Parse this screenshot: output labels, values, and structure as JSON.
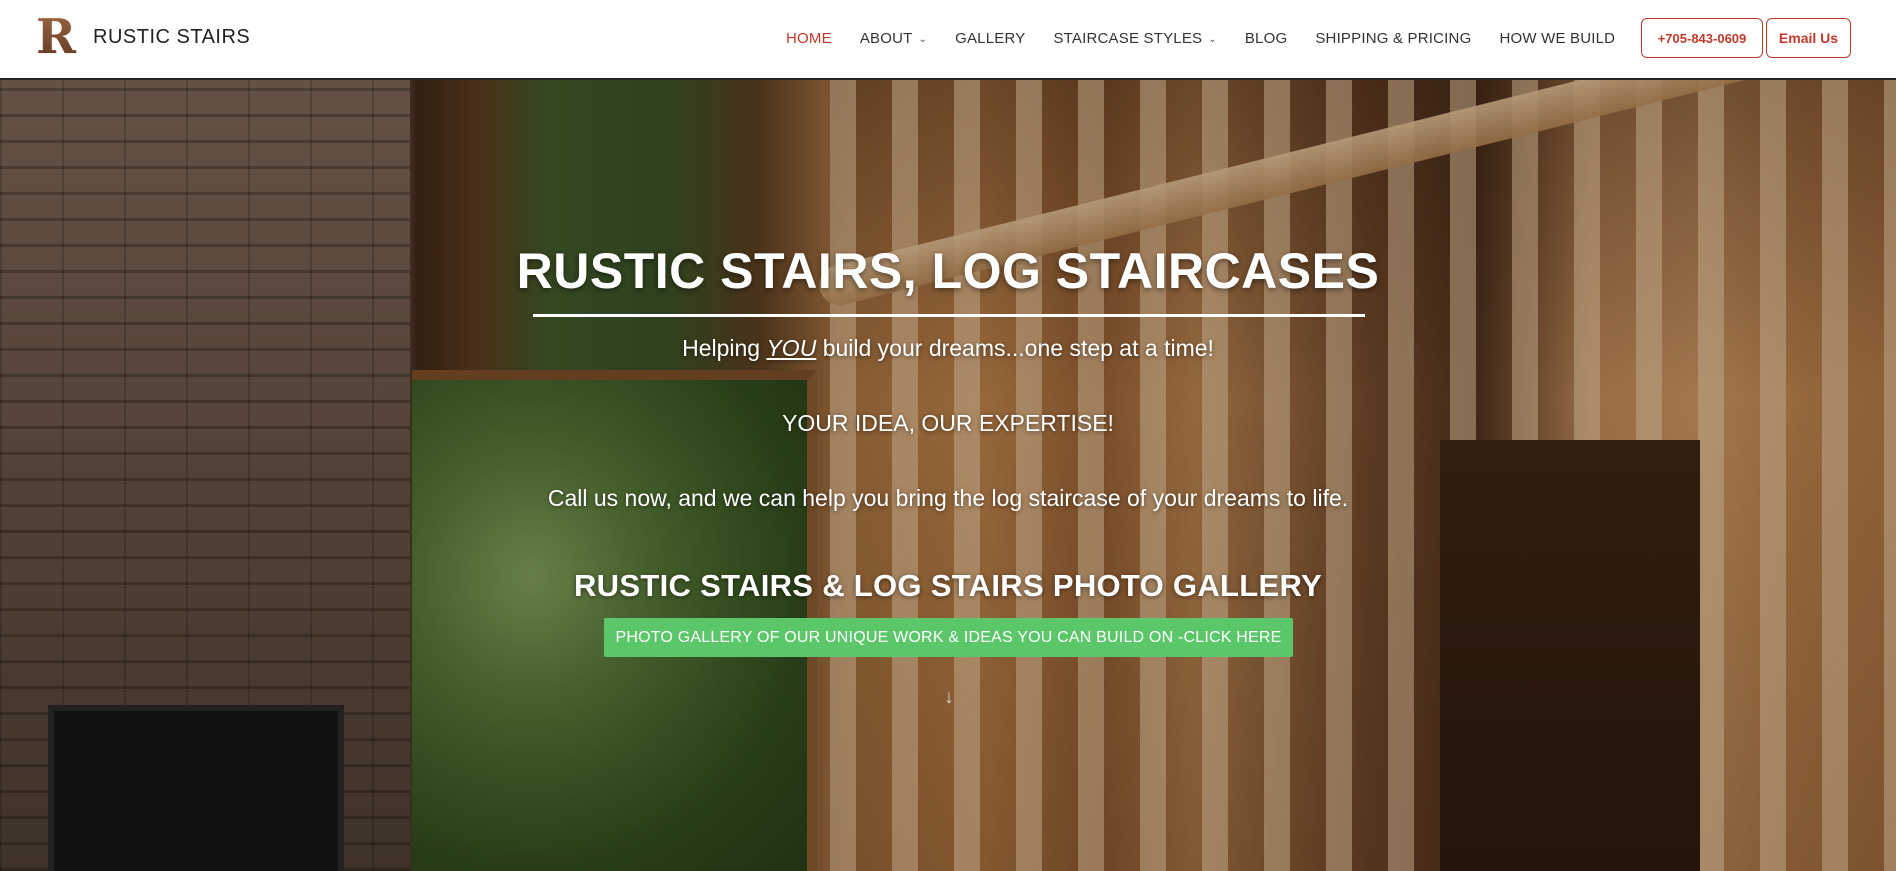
{
  "brand": {
    "logo_letter": "R",
    "name": "RUSTIC STAIRS"
  },
  "nav": {
    "items": [
      {
        "label": "HOME",
        "active": true,
        "dropdown": false
      },
      {
        "label": "ABOUT",
        "active": false,
        "dropdown": true
      },
      {
        "label": "GALLERY",
        "active": false,
        "dropdown": false
      },
      {
        "label": "STAIRCASE STYLES",
        "active": false,
        "dropdown": true
      },
      {
        "label": "BLOG",
        "active": false,
        "dropdown": false
      },
      {
        "label": "SHIPPING & PRICING",
        "active": false,
        "dropdown": false
      },
      {
        "label": "HOW WE BUILD",
        "active": false,
        "dropdown": false
      }
    ],
    "caret_icon": "chevron-down-icon",
    "active_color": "#c0392b"
  },
  "cta": {
    "phone_label": "+705-843-0609",
    "email_label": "Email Us",
    "accent_color": "#c0392b"
  },
  "hero": {
    "title": "RUSTIC STAIRS, LOG STAIRCASES",
    "tagline_before": "Helping ",
    "tagline_emphasis": "YOU",
    "tagline_after": " build your dreams...one step at a time!",
    "idea": "YOUR IDEA,  OUR EXPERTISE!",
    "call": "Call us now,  and we can help you bring the log staircase of your dreams to life.",
    "gallery_heading": "RUSTIC STAIRS & LOG STAIRS PHOTO GALLERY",
    "button_label": "PHOTO GALLERY OF OUR UNIQUE WORK & IDEAS YOU CAN BUILD ON -CLICK HERE",
    "button_color": "#5cc66b",
    "scroll_icon": "arrow-down-icon"
  }
}
